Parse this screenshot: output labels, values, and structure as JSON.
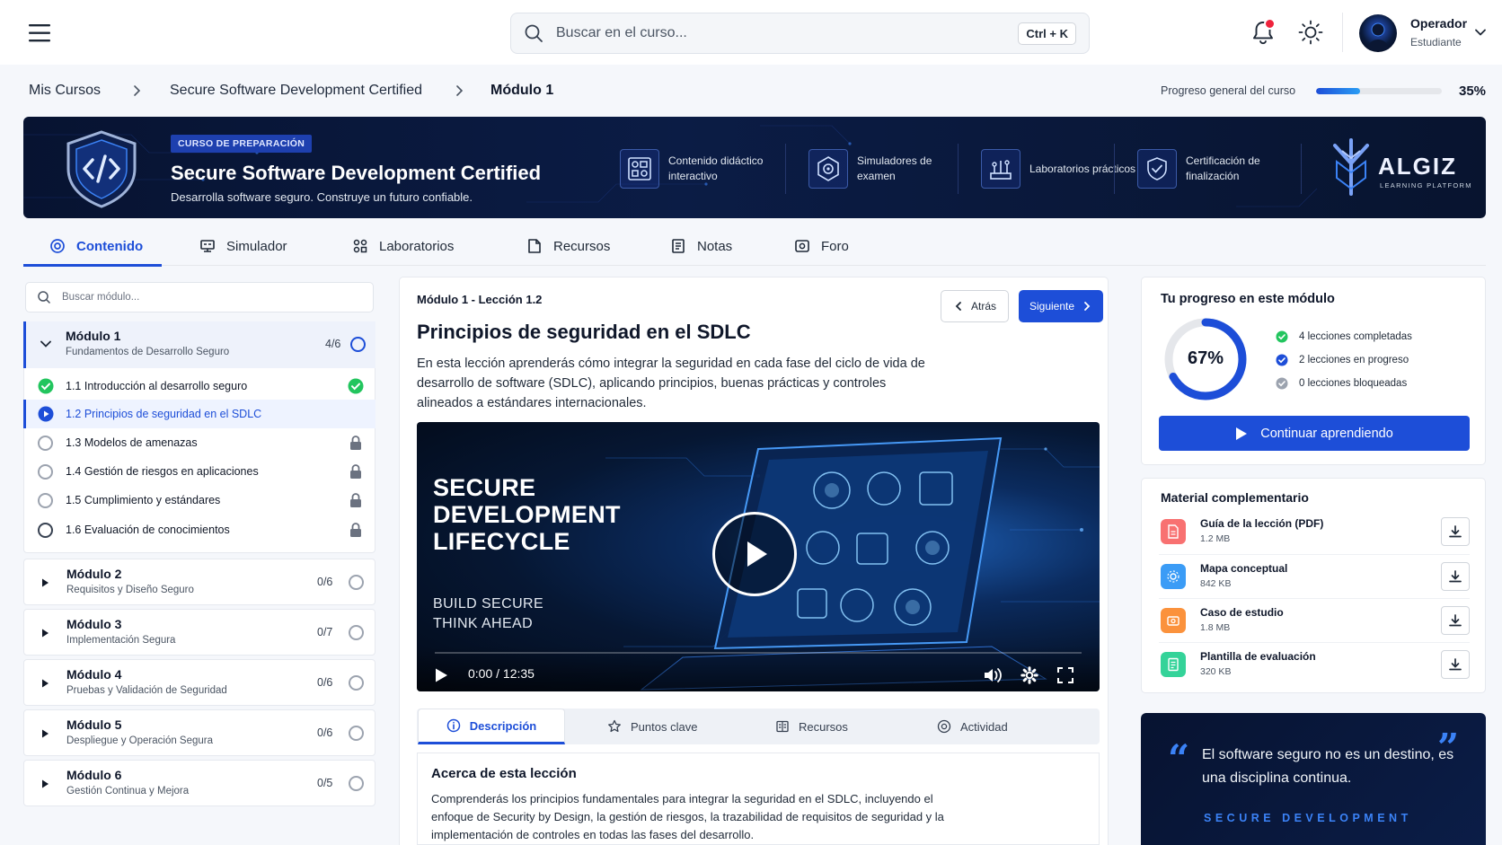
{
  "topbar": {
    "search_placeholder": "Buscar en el curso...",
    "shortcut": "Ctrl + K",
    "user_name": "Operador",
    "user_role": "Estudiante"
  },
  "breadcrumb": {
    "items": [
      "Mis Cursos",
      "Secure Software Development Certified",
      "Módulo 1"
    ],
    "progress_label": "Progreso general del curso",
    "progress_value": 35,
    "progress_text": "35%"
  },
  "hero": {
    "badge": "CURSO DE PREPARACIÓN",
    "title": "Secure Software Development Certified",
    "subtitle": "Desarrolla software seguro. Construye un futuro confiable.",
    "features": [
      {
        "label": "Contenido didáctico interactivo",
        "icon": "interactive-content-icon"
      },
      {
        "label": "Simuladores de examen",
        "icon": "exam-simulator-icon"
      },
      {
        "label": "Laboratorios prácticos",
        "icon": "lab-icon"
      },
      {
        "label": "Certificación de finalización",
        "icon": "certificate-shield-icon"
      }
    ],
    "brand": "ALGIZ",
    "brand_sub": "LEARNING PLATFORM"
  },
  "tabs": [
    {
      "label": "Contenido",
      "icon": "target-icon",
      "active": true
    },
    {
      "label": "Simulador",
      "icon": "simulator-icon"
    },
    {
      "label": "Laboratorios",
      "icon": "lab-grid-icon"
    },
    {
      "label": "Recursos",
      "icon": "resources-icon"
    },
    {
      "label": "Notas",
      "icon": "notes-icon"
    },
    {
      "label": "Foro",
      "icon": "forum-icon"
    }
  ],
  "sidebar": {
    "search_placeholder": "Buscar módulo...",
    "module1": {
      "title": "Módulo 1",
      "subtitle": "Fundamentos de Desarrollo Seguro",
      "count": "4/6",
      "lessons": [
        {
          "label": "1.1 Introducción al desarrollo seguro",
          "state": "done"
        },
        {
          "label": "1.2 Principios de seguridad en el SDLC",
          "state": "current"
        },
        {
          "label": "1.3 Modelos de amenazas",
          "state": "locked"
        },
        {
          "label": "1.4 Gestión de riesgos en aplicaciones",
          "state": "locked"
        },
        {
          "label": "1.5 Cumplimiento y estándares",
          "state": "locked"
        },
        {
          "label": "1.6 Evaluación de conocimientos",
          "state": "locked"
        }
      ]
    },
    "modules": [
      {
        "title": "Módulo 2",
        "subtitle": "Requisitos y Diseño Seguro",
        "count": "0/6"
      },
      {
        "title": "Módulo 3",
        "subtitle": "Implementación Segura",
        "count": "0/7"
      },
      {
        "title": "Módulo 4",
        "subtitle": "Pruebas y Validación de Seguridad",
        "count": "0/6"
      },
      {
        "title": "Módulo 5",
        "subtitle": "Despliegue y Operación Segura",
        "count": "0/6"
      },
      {
        "title": "Módulo 6",
        "subtitle": "Gestión Continua y Mejora",
        "count": "0/5"
      }
    ]
  },
  "lesson": {
    "kicker": "Módulo 1 - Lección 1.2",
    "back_label": "Atrás",
    "next_label": "Siguiente",
    "title": "Principios de seguridad en el SDLC",
    "description": "En esta lección aprenderás cómo integrar la seguridad en cada fase del ciclo de vida de desarrollo de software (SDLC), aplicando principios, buenas prácticas y controles alineados a estándares internacionales.",
    "video": {
      "title_line1": "SECURE",
      "title_line2": "DEVELOPMENT",
      "title_line3": "LIFECYCLE",
      "sub_line1": "BUILD SECURE",
      "sub_line2": "THINK AHEAD",
      "time": "0:00 / 12:35"
    },
    "detail_tabs": [
      {
        "label": "Descripción",
        "icon": "info-icon",
        "active": true
      },
      {
        "label": "Puntos clave",
        "icon": "star-icon"
      },
      {
        "label": "Recursos",
        "icon": "book-icon"
      },
      {
        "label": "Actividad",
        "icon": "activity-icon"
      }
    ],
    "about_title": "Acerca de esta lección",
    "about_text": "Comprenderás los principios fundamentales para integrar la seguridad en el SDLC, incluyendo el enfoque de Security by Design, la gestión de riesgos, la trazabilidad de requisitos de seguridad y la implementación de controles en todas las fases del desarrollo."
  },
  "module_progress": {
    "title": "Tu progreso en este módulo",
    "percent": 67,
    "percent_text": "67%",
    "legend": [
      {
        "label": "4 lecciones completadas",
        "color": "#22c55e"
      },
      {
        "label": "2 lecciones en progreso",
        "color": "#1d4ed8"
      },
      {
        "label": "0 lecciones bloqueadas",
        "color": "#9ca3af"
      }
    ],
    "continue_label": "Continuar aprendiendo"
  },
  "materials": {
    "title": "Material complementario",
    "items": [
      {
        "name": "Guía de la lección (PDF)",
        "size": "1.2 MB",
        "color": "#f87171",
        "icon": "pdf-icon"
      },
      {
        "name": "Mapa conceptual",
        "size": "842 KB",
        "color": "#3b9cf6",
        "icon": "concept-map-icon"
      },
      {
        "name": "Caso de estudio",
        "size": "1.8 MB",
        "color": "#fb923c",
        "icon": "case-study-icon"
      },
      {
        "name": "Plantilla de evaluación",
        "size": "320 KB",
        "color": "#34d399",
        "icon": "template-icon"
      }
    ]
  },
  "quote": {
    "open": "“",
    "close": "”",
    "text": "El software seguro no es un destino, es una disciplina continua.",
    "tag": "SECURE DEVELOPMENT"
  },
  "colors": {
    "accent": "#1d4ed8",
    "hero_bg": "#0b1c45",
    "success": "#22c55e"
  }
}
